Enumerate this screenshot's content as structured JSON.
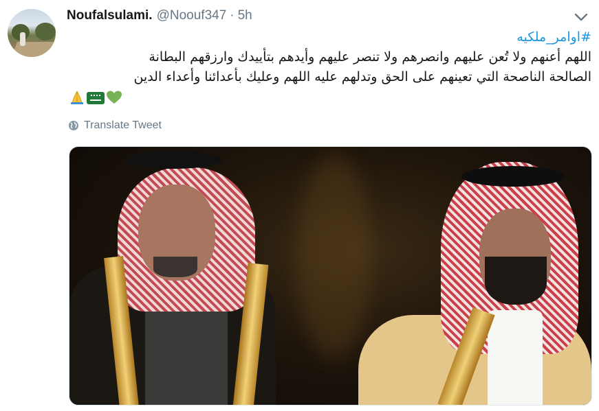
{
  "tweet": {
    "author_name": "Noufalsulami.",
    "handle": "@Noouf347",
    "separator": "·",
    "time": "5h",
    "hashtag": "#اوامر_ملكيه",
    "text_line_1": "اللهم أعنهم ولا تُعن عليهم وانصرهم ولا تنصر عليهم وأيدهم بتأييدك وارزقهم البطانة",
    "text_line_2": "الصالحة الناصحة التي تعينهم على الحق وتدلهم عليه اللهم وعليك بأعدائنا وأعداء الدين",
    "emojis": [
      "folded-hands-emoji",
      "saudi-flag-emoji",
      "green-heart-emoji"
    ],
    "translate_label": "Translate Tweet"
  },
  "icons": {
    "caret": "chevron-down-icon",
    "translate": "globe-icon"
  },
  "colors": {
    "link": "#1b95e0",
    "muted": "#657786",
    "text": "#14171a"
  }
}
